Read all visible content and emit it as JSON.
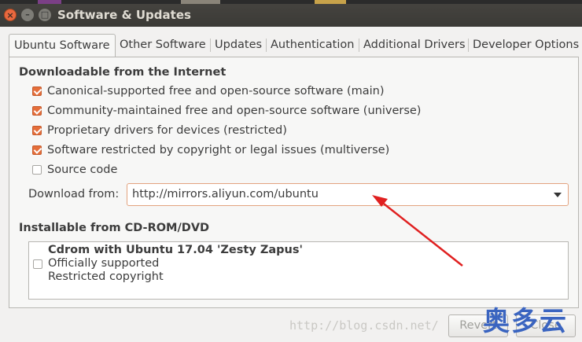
{
  "window": {
    "title": "Software & Updates"
  },
  "tabs": [
    {
      "label": "Ubuntu Software",
      "active": true
    },
    {
      "label": "Other Software",
      "active": false
    },
    {
      "label": "Updates",
      "active": false
    },
    {
      "label": "Authentication",
      "active": false
    },
    {
      "label": "Additional Drivers",
      "active": false
    },
    {
      "label": "Developer Options",
      "active": false
    }
  ],
  "internet": {
    "heading": "Downloadable from the Internet",
    "options": [
      {
        "label": "Canonical-supported free and open-source software (main)",
        "checked": true
      },
      {
        "label": "Community-maintained free and open-source software (universe)",
        "checked": true
      },
      {
        "label": "Proprietary drivers for devices (restricted)",
        "checked": true
      },
      {
        "label": "Software restricted by copyright or legal issues (multiverse)",
        "checked": true
      },
      {
        "label": "Source code",
        "checked": false
      }
    ],
    "download_from_label": "Download from:",
    "download_from_value": "http://mirrors.aliyun.com/ubuntu"
  },
  "cdrom": {
    "heading": "Installable from CD-ROM/DVD",
    "item_title": "Cdrom with Ubuntu 17.04 'Zesty Zapus'",
    "item_line1": "Officially supported",
    "item_line2": "Restricted copyright",
    "checked": false
  },
  "buttons": {
    "revert": "Revert",
    "close": "Close"
  },
  "overlay": {
    "watermark": "http://blog.csdn.net/",
    "logo": "奥多云"
  },
  "colors": {
    "accent": "#e56e3a",
    "annotation_arrow": "#e02020",
    "logo": "#3a64c0"
  }
}
